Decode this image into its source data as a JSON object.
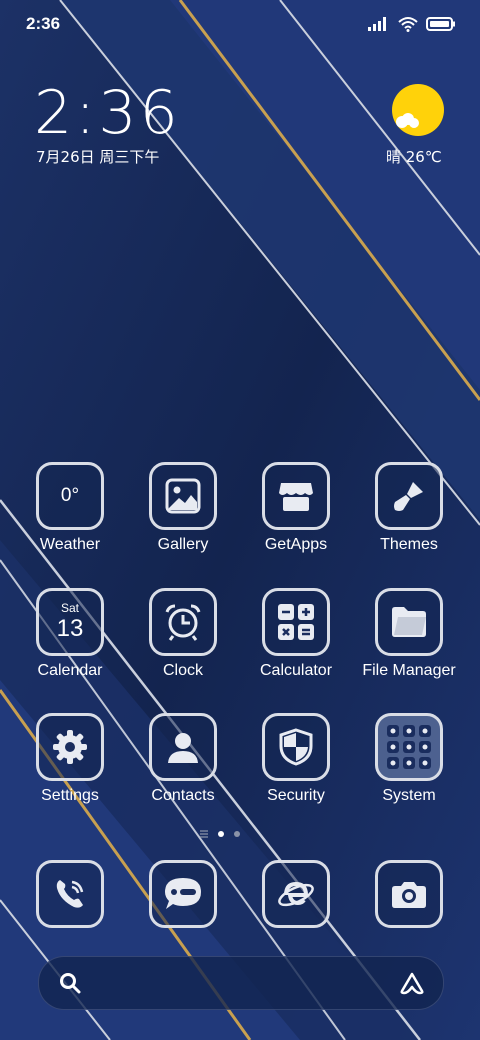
{
  "status_bar": {
    "time": "2:36",
    "icons": [
      "signal-icon",
      "wifi-icon",
      "battery-icon"
    ]
  },
  "clock_widget": {
    "time": "2:36",
    "date": "7月26日 周三下午"
  },
  "weather_widget": {
    "condition_icon": "partly-sunny-icon",
    "text": "晴 26℃",
    "colors": {
      "sun": "#ffd20a"
    }
  },
  "apps": [
    {
      "label": "Weather",
      "icon": "weather-icon",
      "value": "0°"
    },
    {
      "label": "Gallery",
      "icon": "gallery-icon"
    },
    {
      "label": "GetApps",
      "icon": "store-icon"
    },
    {
      "label": "Themes",
      "icon": "brush-icon"
    },
    {
      "label": "Calendar",
      "icon": "calendar-icon",
      "day": "Sat",
      "date": "13"
    },
    {
      "label": "Clock",
      "icon": "alarm-clock-icon"
    },
    {
      "label": "Calculator",
      "icon": "calculator-icon"
    },
    {
      "label": "File Manager",
      "icon": "folder-icon"
    },
    {
      "label": "Settings",
      "icon": "gear-icon"
    },
    {
      "label": "Contacts",
      "icon": "person-icon"
    },
    {
      "label": "Security",
      "icon": "shield-icon"
    },
    {
      "label": "System",
      "icon": "app-folder-icon"
    }
  ],
  "page_indicator": {
    "pages": 2,
    "current": 1,
    "has_menu_glyph": true
  },
  "dock": [
    {
      "icon": "phone-icon",
      "label": ""
    },
    {
      "icon": "messages-icon",
      "label": ""
    },
    {
      "icon": "browser-icon",
      "label": ""
    },
    {
      "icon": "camera-icon",
      "label": ""
    }
  ],
  "search_bar": {
    "left_icon": "search-icon",
    "right_icon": "assistant-icon"
  },
  "theme": {
    "background": "#172a5a",
    "tile_border": "#d9dde6",
    "gold": "#c8a050"
  }
}
